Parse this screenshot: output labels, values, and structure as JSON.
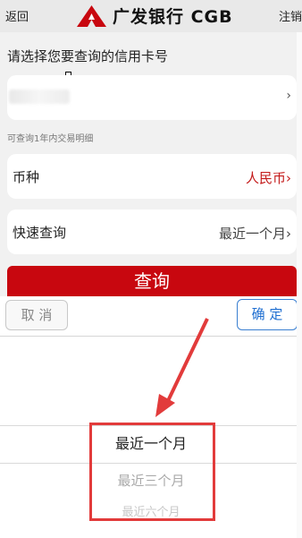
{
  "header": {
    "back_label": "返回",
    "brand": "广发银行 CGB",
    "logout_label": "注销"
  },
  "form": {
    "prompt": "请选择您要查询的信用卡号",
    "card_chevron": "›",
    "hint": "可查询1年内交易明细",
    "currency_label": "币种",
    "currency_value": "人民币›",
    "quick_label": "快速查询",
    "quick_value": "最近一个月›",
    "query_button": "查询"
  },
  "picker": {
    "cancel_label": "取 消",
    "confirm_label": "确 定",
    "options": [
      "最近一个月",
      "最近三个月",
      "最近六个月"
    ],
    "selected": "最近一个月"
  },
  "colors": {
    "brand_red": "#c8070f",
    "annotation_red": "#e23b3b",
    "confirm_blue": "#1f6fd1"
  }
}
